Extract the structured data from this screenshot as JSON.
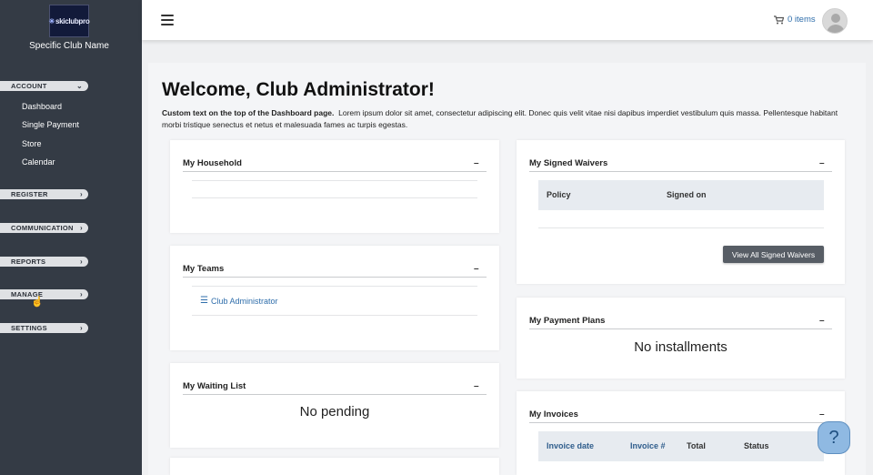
{
  "sidebar": {
    "logo": "skiclubpro",
    "club_name": "Specific Club Name",
    "sections": [
      {
        "label": "ACCOUNT",
        "chevron": "chevron-down-icon"
      },
      {
        "label": "REGISTER",
        "chevron": "chevron-right-icon"
      },
      {
        "label": "COMMUNICATION",
        "chevron": "chevron-right-icon"
      },
      {
        "label": "REPORTS",
        "chevron": "chevron-right-icon"
      },
      {
        "label": "MANAGE",
        "chevron": "chevron-right-icon"
      },
      {
        "label": "SETTINGS",
        "chevron": "chevron-right-icon"
      }
    ],
    "account_items": [
      "Dashboard",
      "Single Payment",
      "Store",
      "Calendar"
    ]
  },
  "topbar": {
    "cart_label": "0 items"
  },
  "main": {
    "welcome": "Welcome, Club Administrator!",
    "intro_bold": "Custom text on the top of the Dashboard page.",
    "intro_text": "Lorem ipsum dolor sit amet, consectetur adipiscing elit. Donec quis velit vitae nisi dapibus imperdiet vestibulum quis massa. Pellentesque habitant morbi tristique senectus et netus et malesuada fames ac turpis egestas."
  },
  "panels": {
    "household": {
      "title": "My Household",
      "collapse": "–"
    },
    "teams": {
      "title": "My Teams",
      "collapse": "–",
      "team_link": "Club Administrator"
    },
    "waiting": {
      "title": "My Waiting List",
      "collapse": "–",
      "message": "No pending"
    },
    "waivers": {
      "title": "My Signed Waivers",
      "collapse": "–",
      "col_policy": "Policy",
      "col_signed": "Signed on",
      "button": "View All Signed Waivers"
    },
    "payment_plans": {
      "title": "My Payment Plans",
      "collapse": "–",
      "message": "No installments"
    },
    "invoices": {
      "title": "My Invoices",
      "collapse": "–",
      "col_date": "Invoice date",
      "col_num": "Invoice #",
      "col_total": "Total",
      "col_status": "Status"
    }
  },
  "help": {
    "label": "?"
  },
  "colors": {
    "sidebar": "#343b45",
    "accent": "#2f6eab",
    "pill": "#dfe1e4"
  }
}
